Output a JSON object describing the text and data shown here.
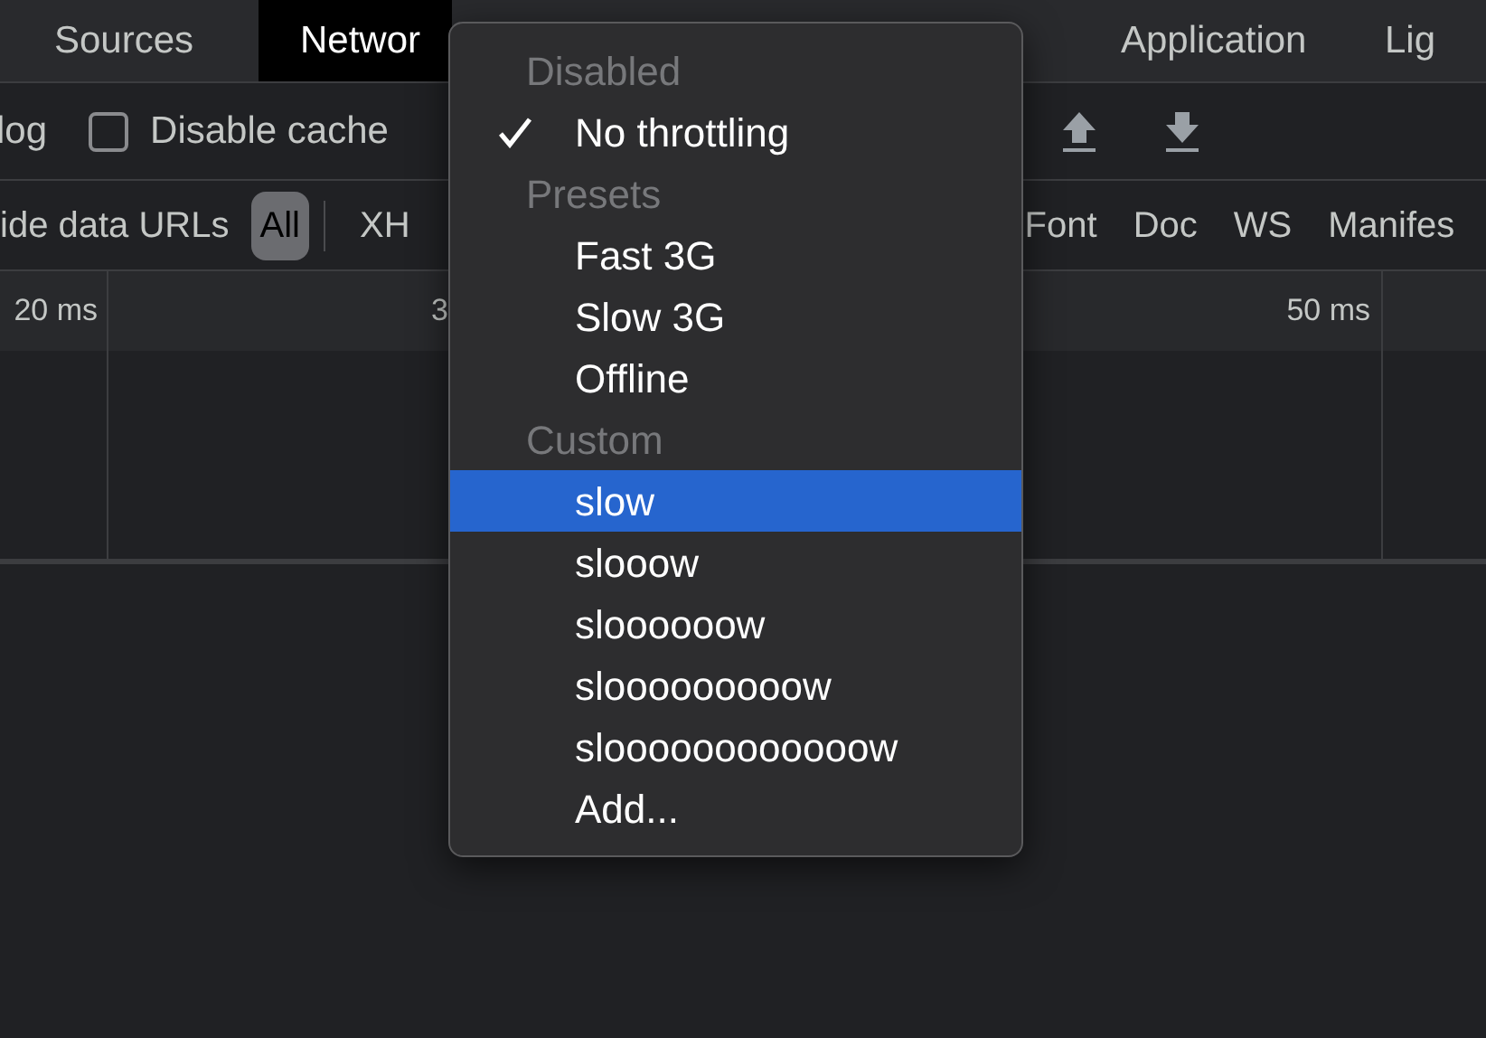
{
  "tabs": [
    {
      "label": "Sources",
      "selected": false
    },
    {
      "label": "Networ",
      "selected": true
    },
    {
      "label": "Application",
      "selected": false
    },
    {
      "label": "Lig",
      "selected": false
    }
  ],
  "toolbar": {
    "preserve_log": "log",
    "disable_cache": {
      "label": "Disable cache",
      "checked": false
    }
  },
  "filter_bar": {
    "hide_data_urls": "ide data URLs",
    "types": [
      {
        "label": "All",
        "selected": true
      },
      {
        "label": "XH",
        "selected": false
      },
      {
        "label": "Font",
        "selected": false
      },
      {
        "label": "Doc",
        "selected": false
      },
      {
        "label": "WS",
        "selected": false
      },
      {
        "label": "Manifes",
        "selected": false
      }
    ]
  },
  "timeline": {
    "ticks": [
      "20 ms",
      "3",
      "50 ms"
    ]
  },
  "throttling_menu": {
    "items": [
      {
        "kind": "header",
        "label": "Disabled"
      },
      {
        "kind": "option",
        "label": "No throttling",
        "checked": true,
        "selected": false
      },
      {
        "kind": "header",
        "label": "Presets"
      },
      {
        "kind": "option",
        "label": "Fast 3G",
        "checked": false,
        "selected": false
      },
      {
        "kind": "option",
        "label": "Slow 3G",
        "checked": false,
        "selected": false
      },
      {
        "kind": "option",
        "label": "Offline",
        "checked": false,
        "selected": false
      },
      {
        "kind": "header",
        "label": "Custom"
      },
      {
        "kind": "option",
        "label": "slow",
        "checked": false,
        "selected": true
      },
      {
        "kind": "option",
        "label": "slooow",
        "checked": false,
        "selected": false
      },
      {
        "kind": "option",
        "label": "sloooooow",
        "checked": false,
        "selected": false
      },
      {
        "kind": "option",
        "label": "slooooooooow",
        "checked": false,
        "selected": false
      },
      {
        "kind": "option",
        "label": "sloooooooooooow",
        "checked": false,
        "selected": false
      },
      {
        "kind": "option",
        "label": "Add...",
        "checked": false,
        "selected": false
      }
    ]
  }
}
